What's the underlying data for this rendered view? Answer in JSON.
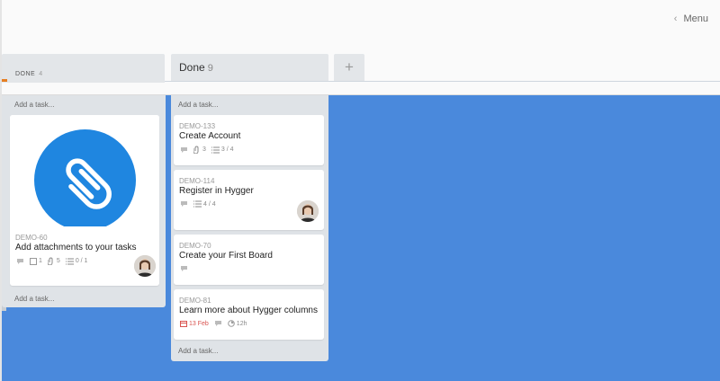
{
  "header": {
    "menu_label": "Menu"
  },
  "columns": {
    "left": {
      "title": "DONE",
      "count": "4",
      "top_add": "Add a task...",
      "bottom_add": "Add a task..."
    },
    "right": {
      "title": "Done",
      "count": "9",
      "top_add": "Add a task...",
      "bottom_add": "Add a task..."
    }
  },
  "cards": {
    "attach": {
      "id": "DEMO-60",
      "title": "Add attachments to your tasks",
      "checks": "1",
      "files": "5",
      "subtasks": "0 / 1"
    },
    "c133": {
      "id": "DEMO-133",
      "title": "Create Account",
      "files": "3",
      "subtasks": "3 / 4"
    },
    "c114": {
      "id": "DEMO-114",
      "title": "Register in Hygger",
      "subtasks": "4 / 4"
    },
    "c70": {
      "id": "DEMO-70",
      "title": "Create your First Board"
    },
    "c81": {
      "id": "DEMO-81",
      "title": "Learn more about Hygger columns",
      "date": "13 Feb",
      "estimate": "12h"
    }
  },
  "icons": {
    "comment": "comment-icon",
    "paperclip": "paperclip-icon",
    "checklist": "checklist-icon",
    "checkbox": "checkbox-icon",
    "calendar": "calendar-icon",
    "timer": "timer-icon",
    "plus": "plus-icon",
    "chevron": "chevron-left-icon"
  },
  "colors": {
    "board_bg": "#4a89dc",
    "accent_orange": "#e67e22",
    "attachment_blue": "#1f86e0",
    "date_red": "#d9534f"
  }
}
